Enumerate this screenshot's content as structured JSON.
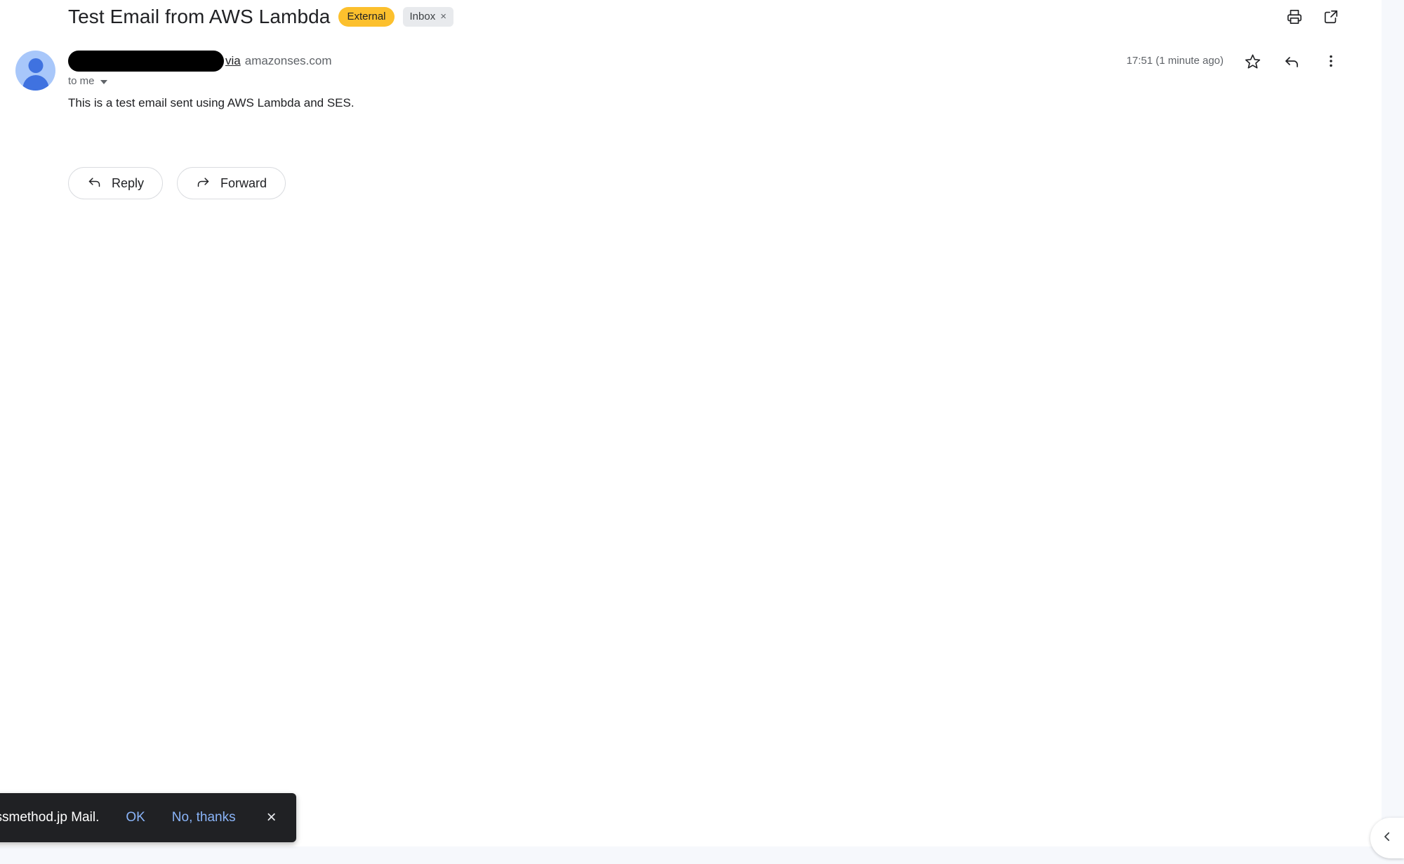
{
  "header": {
    "subject": "Test Email from AWS Lambda",
    "external_badge": "External",
    "inbox_chip": "Inbox",
    "inbox_chip_remove": "×",
    "print_icon": "print-icon",
    "popout_icon": "open-in-new-icon"
  },
  "sender": {
    "name_redacted": "",
    "via_label": "via",
    "via_domain": "amazonses.com",
    "recipient": "to me",
    "timestamp": "17:51 (1 minute ago)",
    "star_icon": "star-icon",
    "reply_icon": "reply-icon",
    "more_icon": "more-vert-icon"
  },
  "body": {
    "text": "This is a test email sent using AWS Lambda and SES."
  },
  "actions": {
    "reply_label": "Reply",
    "forward_label": "Forward"
  },
  "snackbar": {
    "message": "Classmethod.jp Mail.",
    "ok_label": "OK",
    "dismiss_label": "No, thanks",
    "close_label": "×"
  },
  "side_panel": {
    "toggle_icon": "chevron-left-icon"
  },
  "colors": {
    "external_badge_bg": "#fcc02d",
    "inbox_chip_bg": "#e8eaed",
    "snackbar_bg": "#202124",
    "snackbar_action": "#8ab4f8",
    "avatar_bg": "#a8c7fa",
    "avatar_fg": "#3f72e0",
    "text_primary": "#202124",
    "text_secondary": "#5f6368",
    "edge_strip": "#f6f8fc"
  }
}
